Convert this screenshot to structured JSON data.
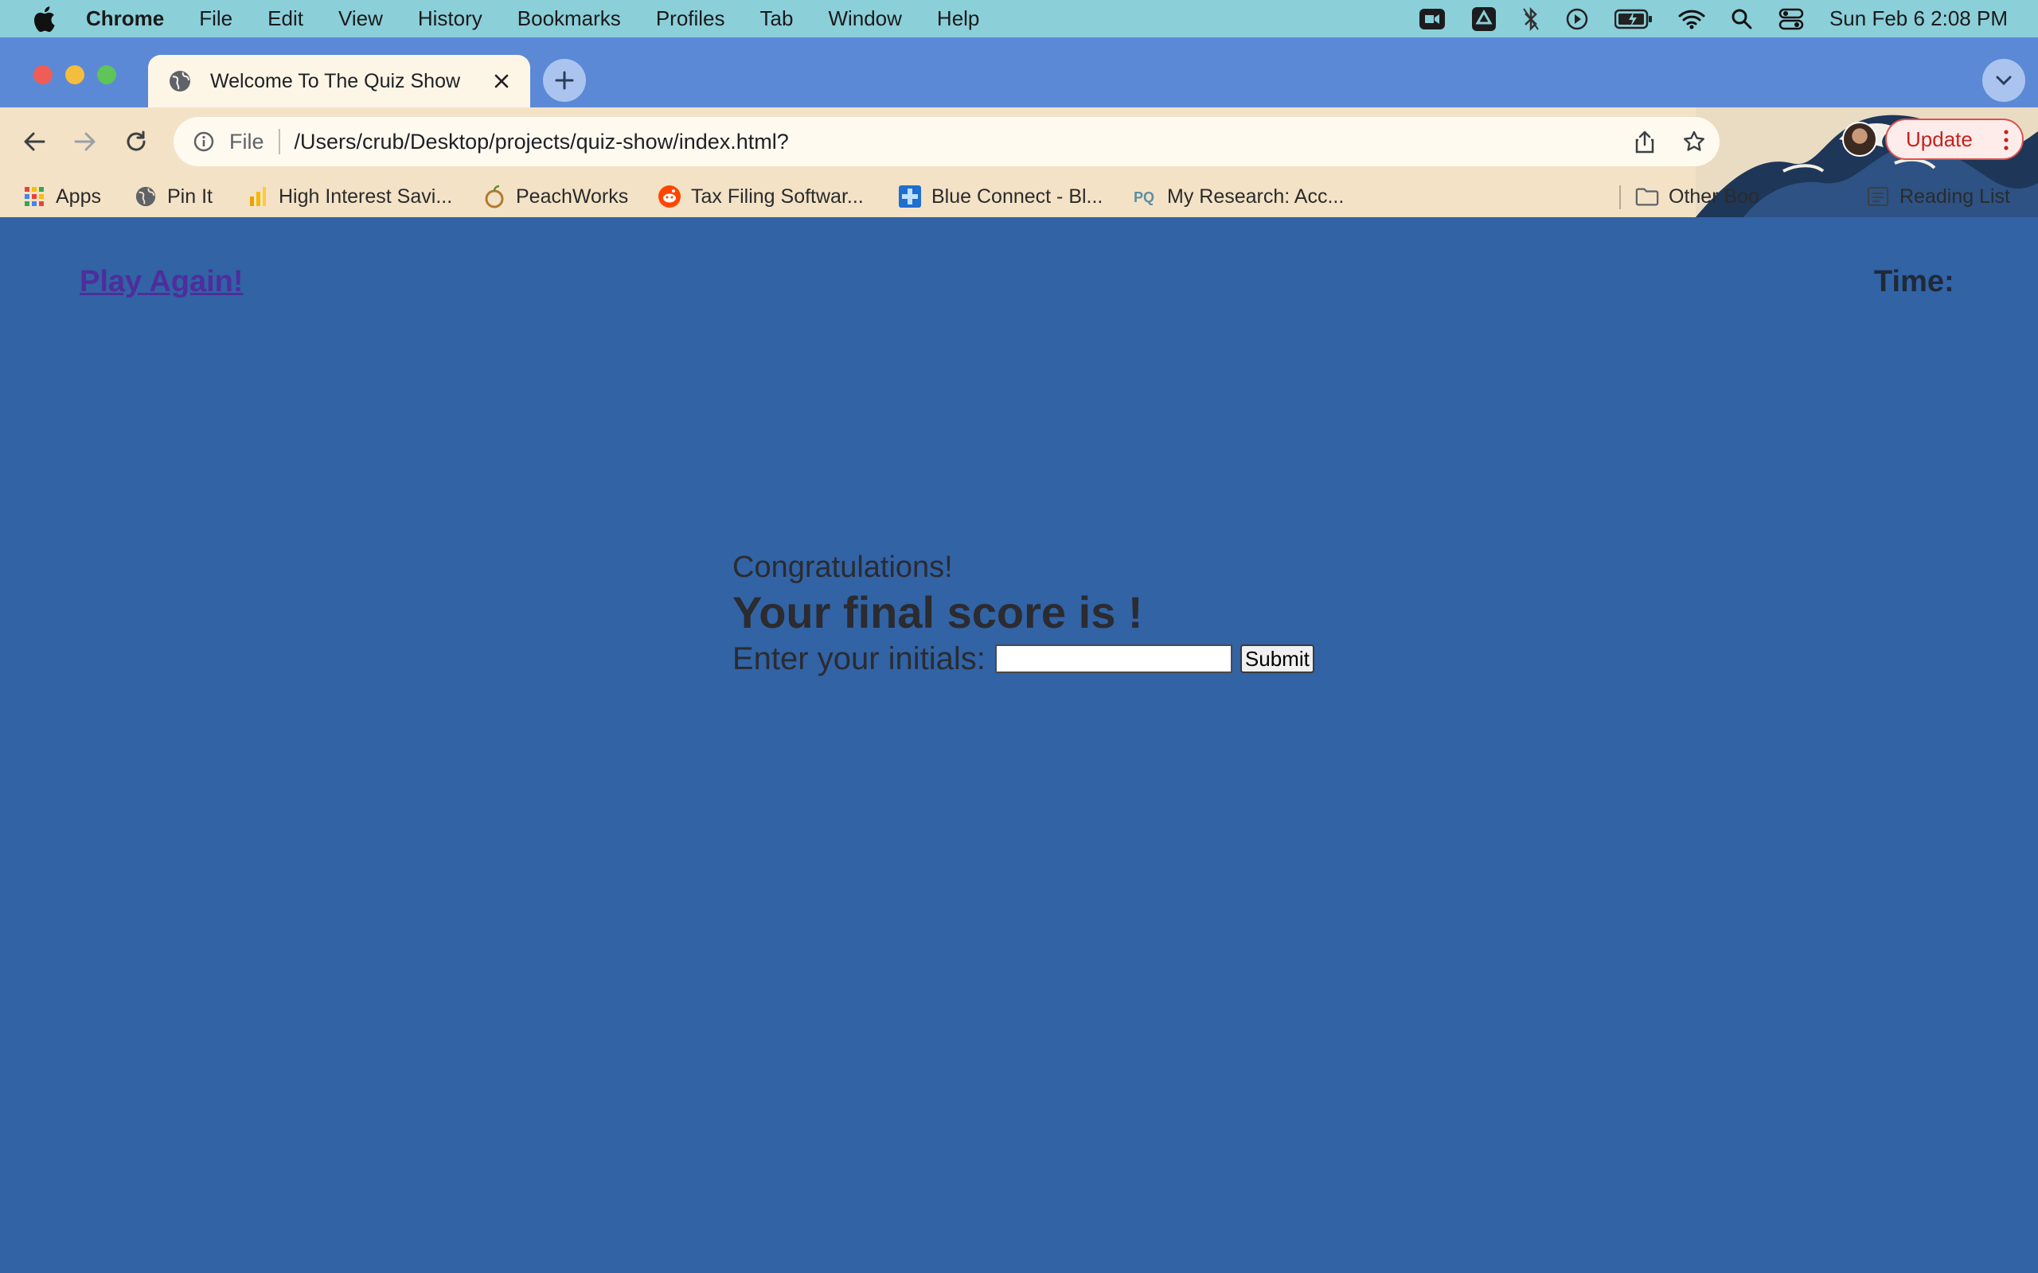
{
  "menubar": {
    "app_name": "Chrome",
    "items": [
      "File",
      "Edit",
      "View",
      "History",
      "Bookmarks",
      "Profiles",
      "Tab",
      "Window",
      "Help"
    ],
    "clock": "Sun Feb 6  2:08 PM"
  },
  "tab": {
    "title": "Welcome To The Quiz Show"
  },
  "toolbar": {
    "scheme_label": "File",
    "url": "/Users/crub/Desktop/projects/quiz-show/index.html?",
    "update_label": "Update"
  },
  "bookmarks": {
    "apps": "Apps",
    "items": [
      "Pin It",
      "High Interest Savi...",
      "PeachWorks",
      "Tax Filing Softwar...",
      "Blue Connect - Bl...",
      "My Research: Acc..."
    ],
    "other": "Other Boo",
    "reading_list": "Reading List"
  },
  "page": {
    "play_again": "Play Again!",
    "time_label": "Time:",
    "time_value": "",
    "congrats": "Congratulations!",
    "final_score_prefix": "Your final score is ",
    "final_score_value": "",
    "final_score_suffix": "!",
    "initials_label": "Enter your initials:",
    "initials_value": "",
    "submit_label": "Submit"
  },
  "colors": {
    "page_background": "#3163a5",
    "menubar": "#8bcfd9",
    "tabstrip": "#5b89d6",
    "link": "#4f2d9c",
    "update_red": "#c5221f"
  }
}
